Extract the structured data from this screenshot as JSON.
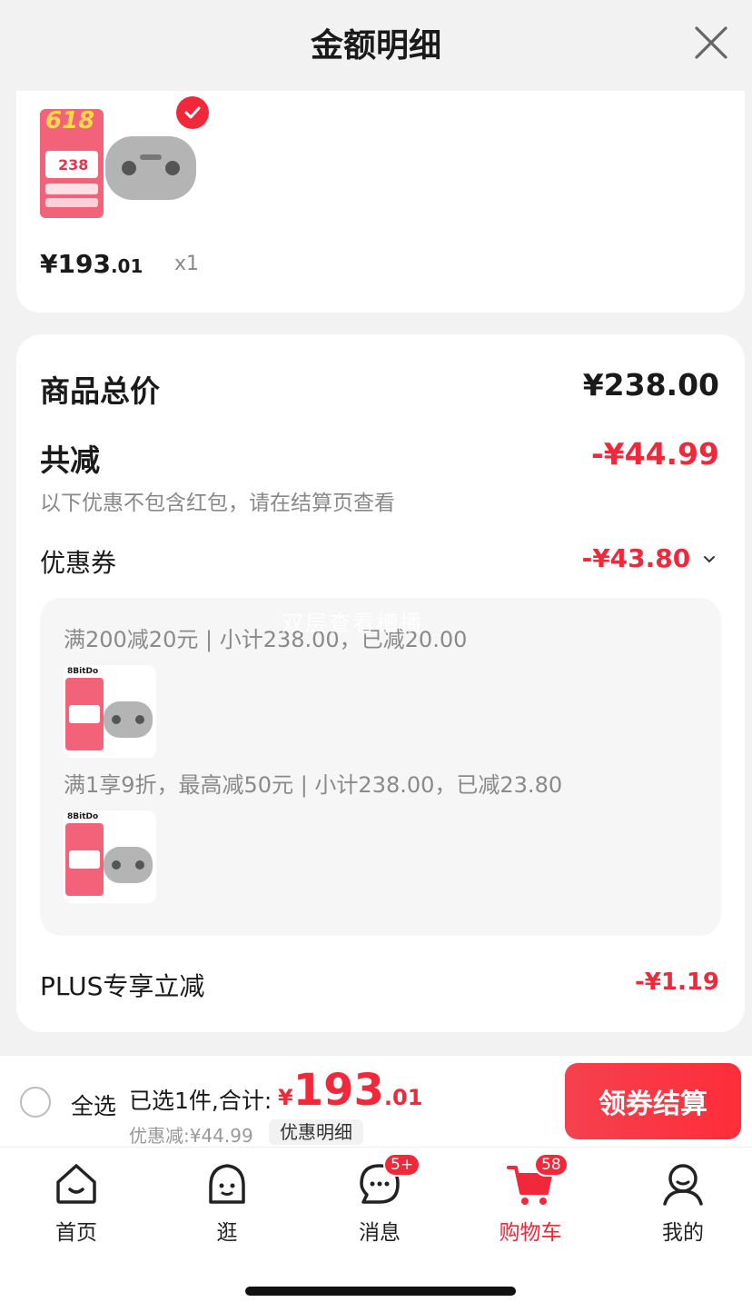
{
  "header": {
    "title": "金额明细"
  },
  "product": {
    "price_int": "¥193",
    "price_dec": ".01",
    "qty": "x1",
    "thumb_banner": "618",
    "thumb_price": "238"
  },
  "summary": {
    "total_label": "商品总价",
    "total_value": "¥238.00",
    "reduce_label": "共减",
    "reduce_value": "-¥44.99",
    "note": "以下优惠不包含红包，请在结算页查看",
    "coupon_label": "优惠券",
    "coupon_value": "-¥43.80",
    "coupons": [
      {
        "text": "满200减20元 | 小计238.00，已减20.00"
      },
      {
        "text": "满1享9折，最高减50元 | 小计238.00，已减23.80"
      }
    ],
    "brand": "8BitDo",
    "plus_label": "PLUS专享立减",
    "plus_value": "-¥1.19",
    "watermark": "双层查看槽播"
  },
  "bottom_bar": {
    "select_all": "全选",
    "selected_text": "已选1件,合计:",
    "price_currency": "¥",
    "price_int": "193",
    "price_dec": ".01",
    "discount_note": "优惠减:¥44.99",
    "detail_pill": "优惠明细",
    "checkout": "领券结算"
  },
  "tabs": [
    {
      "label": "首页",
      "icon": "home-icon"
    },
    {
      "label": "逛",
      "icon": "browse-icon"
    },
    {
      "label": "消息",
      "icon": "message-icon",
      "badge": "5+"
    },
    {
      "label": "购物车",
      "icon": "cart-icon",
      "badge": "58",
      "active": true
    },
    {
      "label": "我的",
      "icon": "profile-icon"
    }
  ],
  "colors": {
    "accent": "#f0283a"
  }
}
